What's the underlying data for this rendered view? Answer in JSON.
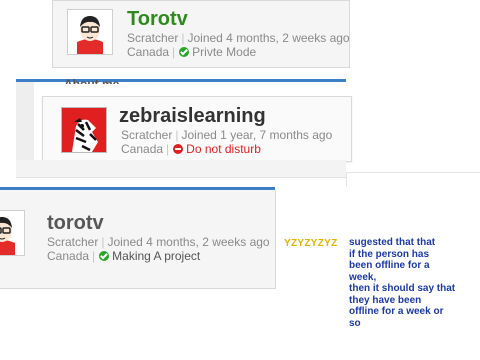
{
  "cards": [
    {
      "username": "Torotv",
      "role": "Scratcher",
      "joined": "Joined 4 months, 2 weeks ago",
      "location": "Canada",
      "status": "Privte Mode",
      "status_color": "#2aa52a",
      "username_color": "#2f8a1e",
      "avatar_icon": "cartoon-boy-avatar-icon"
    },
    {
      "username": "zebraislearning",
      "role": "Scratcher",
      "joined": "Joined 1 year, 7 months ago",
      "location": "Canada",
      "status": "Do not disturb",
      "status_color": "#e21f1f",
      "username_color": "#333333",
      "avatar_icon": "zebra-avatar-icon"
    },
    {
      "username": "torotv",
      "role": "Scratcher",
      "joined": "Joined 4 months, 2 weeks ago",
      "location": "Canada",
      "status": "Making A project",
      "status_color": "#2aa52a",
      "username_color": "#575757",
      "avatar_icon": "cartoon-boy-avatar-icon"
    }
  ],
  "partial_heading": "About me",
  "tag": "YZYZYZYZ",
  "note_lines": [
    "sugested that that",
    "if the  person has",
    "been offline for a",
    "week,",
    "then it should say that",
    "they have been",
    "offline for a week or",
    "so"
  ]
}
